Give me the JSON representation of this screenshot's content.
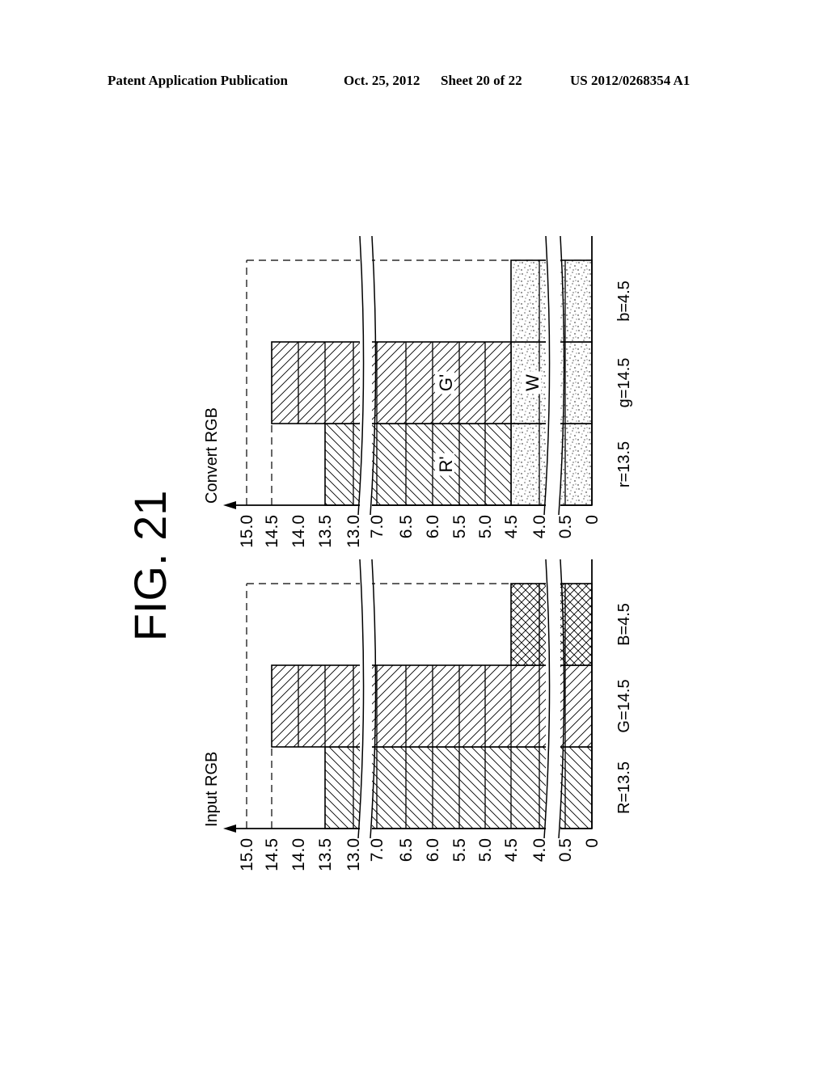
{
  "header": {
    "publication": "Patent Application Publication",
    "date": "Oct. 25, 2012",
    "sheet": "Sheet 20 of 22",
    "number": "US 2012/0268354 A1"
  },
  "figure_label": "FIG. 21",
  "chart_data": [
    {
      "type": "bar",
      "stacked": true,
      "orientation": "rotated 90° counterclockwise on page",
      "title": "Input RGB",
      "categories": [
        "R=13.5",
        "G=14.5",
        "B=4.5"
      ],
      "series": [
        {
          "name": "R",
          "pattern": "backslash-hatch",
          "values": [
            13.5,
            0,
            0
          ]
        },
        {
          "name": "G",
          "pattern": "slash-hatch",
          "values": [
            0,
            14.5,
            0
          ]
        },
        {
          "name": "B",
          "pattern": "cross-hatch",
          "values": [
            0,
            0,
            4.5
          ]
        }
      ],
      "value_ticks": [
        "15.0",
        "14.5",
        "14.0",
        "13.5",
        "13.0",
        "7.0",
        "6.5",
        "6.0",
        "5.5",
        "5.0",
        "4.5",
        "4.0",
        "0.5",
        "0"
      ],
      "axis_breaks": [
        [
          4.0,
          0.5
        ],
        [
          13.0,
          7.0
        ]
      ],
      "reference_lines": [
        15.0,
        14.5
      ],
      "ylim": [
        0,
        15.0
      ],
      "segment_labels": []
    },
    {
      "type": "bar",
      "stacked": true,
      "orientation": "rotated 90° counterclockwise on page",
      "title": "Convert RGB",
      "categories": [
        "r=13.5",
        "g=14.5",
        "b=4.5"
      ],
      "series": [
        {
          "name": "W",
          "pattern": "stipple",
          "values": [
            4.5,
            4.5,
            4.5
          ]
        },
        {
          "name": "R'",
          "pattern": "backslash-hatch",
          "values": [
            9.0,
            0,
            0
          ]
        },
        {
          "name": "G'",
          "pattern": "slash-hatch",
          "values": [
            0,
            10.0,
            0
          ]
        }
      ],
      "value_ticks": [
        "15.0",
        "14.5",
        "14.0",
        "13.5",
        "13.0",
        "7.0",
        "6.5",
        "6.0",
        "5.5",
        "5.0",
        "4.5",
        "4.0",
        "0.5",
        "0"
      ],
      "axis_breaks": [
        [
          4.0,
          0.5
        ],
        [
          13.0,
          7.0
        ]
      ],
      "reference_lines": [
        15.0,
        14.5
      ],
      "ylim": [
        0,
        15.0
      ],
      "segment_labels": [
        "R'",
        "G'",
        "W"
      ]
    }
  ]
}
